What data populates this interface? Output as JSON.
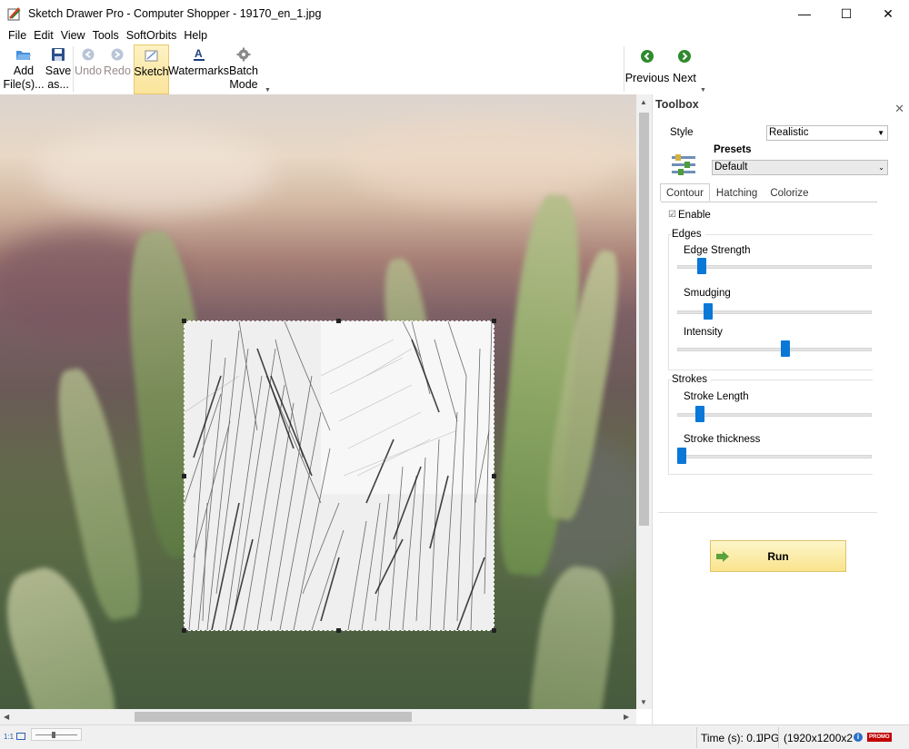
{
  "window": {
    "title": "Sketch Drawer Pro - Computer Shopper - 19170_en_1.jpg",
    "minimize": "—",
    "maximize": "☐",
    "close": "✕"
  },
  "menu": [
    "File",
    "Edit",
    "View",
    "Tools",
    "SoftOrbits",
    "Help"
  ],
  "toolbar": {
    "add_files_line1": "Add",
    "add_files_line2": "File(s)...",
    "save_as_line1": "Save",
    "save_as_line2": "as...",
    "undo": "Undo",
    "redo": "Redo",
    "sketch": "Sketch",
    "watermarks": "Watermarks",
    "batch_mode_line1": "Batch",
    "batch_mode_line2": "Mode",
    "previous": "Previous",
    "next": "Next"
  },
  "toolbox": {
    "title": "Toolbox",
    "close": "✕",
    "style_label": "Style",
    "style_value": "Realistic",
    "presets_label": "Presets",
    "presets_value": "Default",
    "tabs": [
      "Contour",
      "Hatching",
      "Colorize"
    ],
    "active_tab": "Contour",
    "enable_checkbox": "☑",
    "enable_label": "Enable",
    "edges_group": "Edges",
    "edge_strength_label": "Edge Strength",
    "smudging_label": "Smudging",
    "intensity_label": "Intensity",
    "strokes_group": "Strokes",
    "stroke_length_label": "Stroke Length",
    "stroke_thickness_label": "Stroke thickness",
    "sliders": {
      "edge_strength": 0.11,
      "smudging": 0.14,
      "intensity": 0.56,
      "stroke_length": 0.1,
      "stroke_thickness": 0.0
    },
    "run_label": "Run"
  },
  "statusbar": {
    "zoom_label": "1:1",
    "time_text": "Time (s): 0.1",
    "format_text": "JPG",
    "size_text": "(1920x1200x2",
    "info_icon": "i",
    "promo_badge": "PROMO"
  },
  "colors": {
    "accent_blue": "#0a78d7",
    "run_yellow": "#f9e38d",
    "promo_red": "#c00000"
  }
}
